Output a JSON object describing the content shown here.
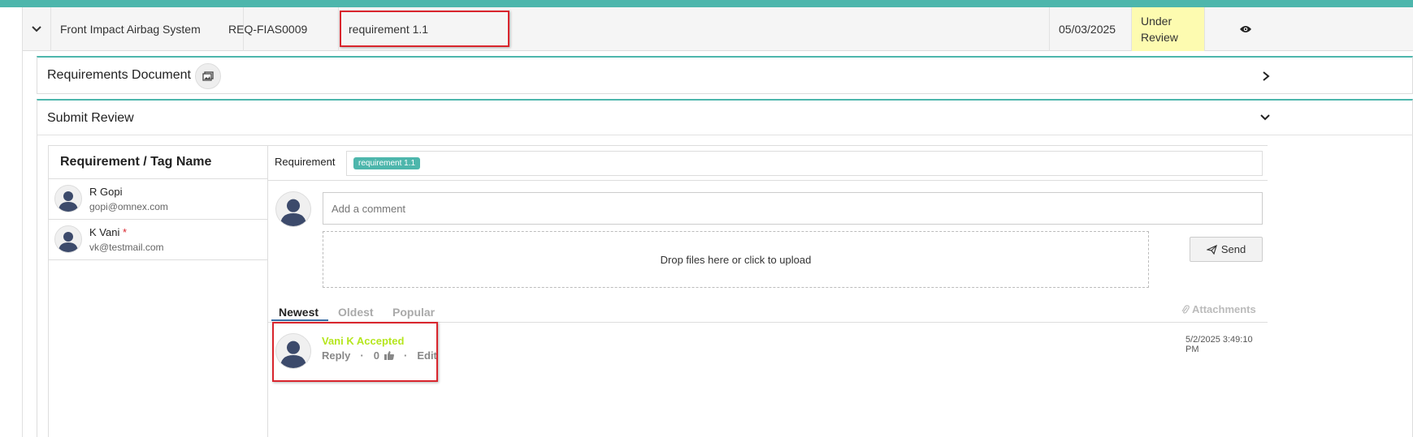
{
  "row": {
    "system": "Front Impact Airbag System",
    "req_id": "REQ-FIAS0009",
    "req_name": "requirement 1.1",
    "date": "05/03/2025",
    "status": "Under Review"
  },
  "req_doc": {
    "title": "Requirements Document"
  },
  "submit_review": {
    "title": "Submit Review"
  },
  "left": {
    "header": "Requirement / Tag Name",
    "users": [
      {
        "name": "R Gopi",
        "email": "gopi@omnex.com",
        "required": ""
      },
      {
        "name": "K Vani",
        "email": "vk@testmail.com",
        "required": "*"
      }
    ]
  },
  "right": {
    "req_label": "Requirement",
    "req_tag": "requirement 1.1",
    "comment_placeholder": "Add a comment",
    "drop_text": "Drop files here or click to upload",
    "send_label": "Send",
    "tabs": [
      "Newest",
      "Oldest",
      "Popular"
    ],
    "attachments_label": "Attachments",
    "comment": {
      "title": "Vani K Accepted",
      "reply": "Reply",
      "likes": "0",
      "edit": "Edit",
      "timestamp": "5/2/2025 3:49:10 PM"
    }
  },
  "colors": {
    "accent": "#4db6ac",
    "status_bg": "#fdfbb0",
    "highlight": "#d9252d",
    "comment_title": "#b5e61d"
  }
}
